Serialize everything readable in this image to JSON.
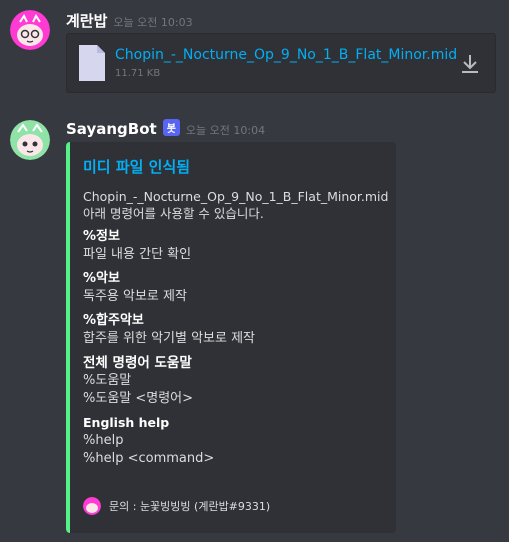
{
  "messages": [
    {
      "username": "계란밥",
      "timestamp": "오늘 오전 10:03",
      "attachment": {
        "file_name": "Chopin_-_Nocturne_Op_9_No_1_B_Flat_Minor.mid",
        "file_size": "11.71 KB",
        "icon": "file-icon",
        "download_icon": "download-icon"
      }
    },
    {
      "username": "SayangBot",
      "bot_tag": "봇",
      "timestamp": "오늘 오전 10:04",
      "embed": {
        "accent_color": "#57f287",
        "title": "미디 파일 인식됨",
        "description_line1": "Chopin_-_Nocturne_Op_9_No_1_B_Flat_Minor.mid",
        "description_line2": "아래 명령어를 사용할 수 있습니다.",
        "fields": [
          {
            "name": "%정보",
            "value": "파일 내용 간단 확인"
          },
          {
            "name": "%악보",
            "value": "독주용 악보로 제작"
          },
          {
            "name": "%합주악보",
            "value": "합주를 위한 악기별 악보로 제작"
          },
          {
            "name": "전체 명령어 도움말",
            "value_line1": "%도움말",
            "value_line2": "%도움말 <명령어>"
          },
          {
            "name": "English help",
            "value_line1": "%help",
            "value_line2": "%help <command>"
          }
        ],
        "footer": "문의 : 눈꽃빙빙빙 (계란밥#9331)"
      }
    }
  ],
  "colors": {
    "background": "#36393f",
    "link": "#00aff4",
    "bot_tag": "#5865f2"
  }
}
